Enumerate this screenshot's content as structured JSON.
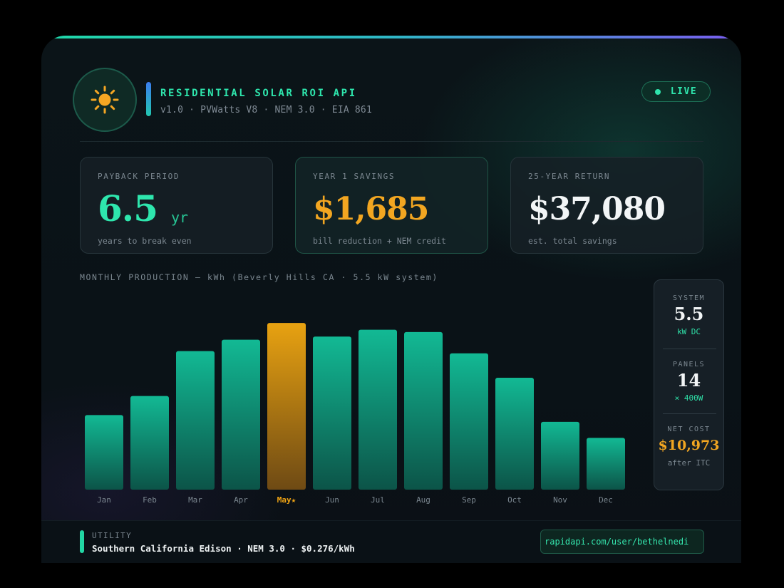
{
  "header": {
    "icon": "sun-icon",
    "title": "RESIDENTIAL SOLAR ROI API",
    "subtitle": "v1.0 · PVWatts V8 · NEM 3.0 · EIA 861",
    "status": "LIVE"
  },
  "stats": [
    {
      "label": "PAYBACK PERIOD",
      "value": "6.5",
      "unit": "yr",
      "caption": "years to break even"
    },
    {
      "label": "YEAR 1 SAVINGS",
      "value": "$1,685",
      "caption": "bill reduction + NEM credit"
    },
    {
      "label": "25-YEAR RETURN",
      "value": "$37,080",
      "caption": "est. total savings"
    }
  ],
  "chart_title": "MONTHLY PRODUCTION — kWh (Beverly Hills CA · 5.5 kW system)",
  "chart_data": {
    "type": "bar",
    "categories": [
      "Jan",
      "Feb",
      "Mar",
      "Apr",
      "May★",
      "Jun",
      "Jul",
      "Aug",
      "Sep",
      "Oct",
      "Nov",
      "Dec"
    ],
    "values": [
      490,
      615,
      910,
      985,
      1095,
      1005,
      1050,
      1035,
      895,
      735,
      445,
      340
    ],
    "highlight_index": 4,
    "ylim": [
      0,
      1100
    ],
    "grid": false,
    "colors": {
      "bar": "#16b38d",
      "highlight": "#f0a414"
    }
  },
  "side": {
    "system_label": "SYSTEM",
    "system_value": "5.5",
    "system_unit": "kW DC",
    "panels_label": "PANELS",
    "panels_value": "14",
    "panels_unit": "× 400W",
    "cost_label": "NET COST",
    "cost_value": "$10,973",
    "cost_unit": "after ITC"
  },
  "footer": {
    "label": "UTILITY",
    "value": "Southern California Edison · NEM 3.0 · $0.276/kWh",
    "link": "rapidapi.com/user/bethelnedi"
  }
}
